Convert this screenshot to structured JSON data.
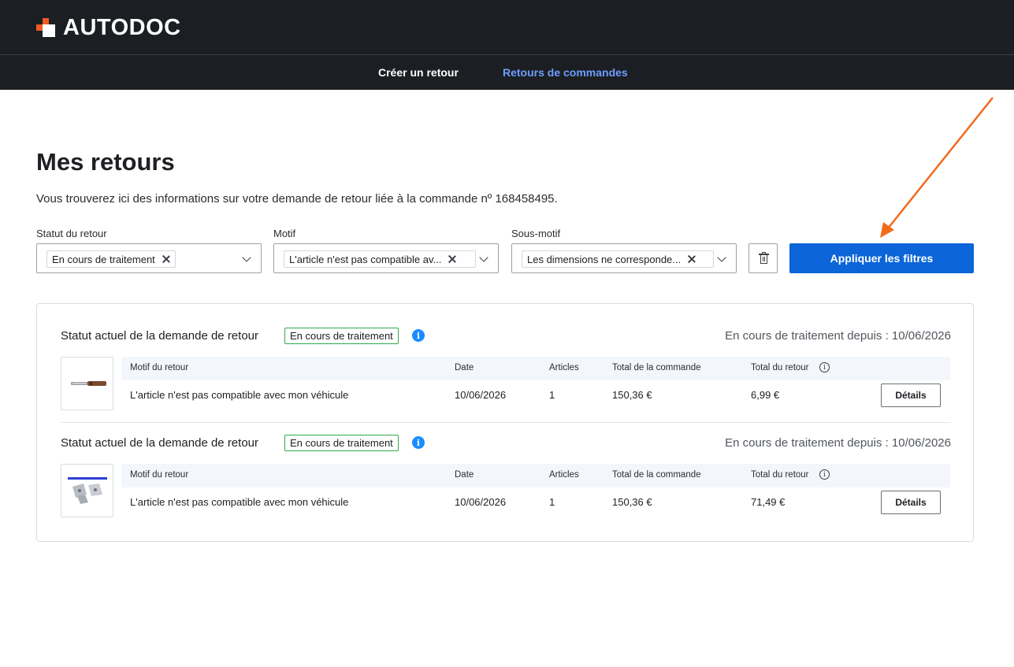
{
  "brand": {
    "name": "AUTODOC",
    "accent": "#f15a22"
  },
  "nav": {
    "items": [
      {
        "label": "Créer un retour",
        "active": false
      },
      {
        "label": "Retours de commandes",
        "active": true
      }
    ]
  },
  "page": {
    "title": "Mes retours",
    "subtitle": "Vous trouverez ici des informations sur votre demande de retour liée à la commande nº 168458495."
  },
  "filters": {
    "status": {
      "label": "Statut du retour",
      "value": "En cours de traitement"
    },
    "reason": {
      "label": "Motif",
      "value": "L'article n'est pas compatible av..."
    },
    "subreason": {
      "label": "Sous-motif",
      "value": "Les dimensions ne corresponde..."
    },
    "clear_icon": "trash-icon",
    "apply_label": "Appliquer les filtres"
  },
  "table_headers": {
    "reason": "Motif du retour",
    "date": "Date",
    "articles": "Articles",
    "order_total": "Total de la commande",
    "return_total": "Total du retour"
  },
  "returns": [
    {
      "status_title": "Statut actuel de la demande de retour",
      "status_badge": "En cours de traitement",
      "since": "En cours de traitement depuis : 10/06/2026",
      "reason": "L'article n'est pas compatible avec mon véhicule",
      "date": "10/06/2026",
      "articles": "1",
      "order_total": "150,36 €",
      "return_total": "6,99 €",
      "details_label": "Détails"
    },
    {
      "status_title": "Statut actuel de la demande de retour",
      "status_badge": "En cours de traitement",
      "since": "En cours de traitement depuis : 10/06/2026",
      "reason": "L'article n'est pas compatible avec mon véhicule",
      "date": "10/06/2026",
      "articles": "1",
      "order_total": "150,36 €",
      "return_total": "71,49 €",
      "details_label": "Détails"
    }
  ],
  "colors": {
    "header_bg": "#1b1e22",
    "nav_active": "#6e9dff",
    "primary_button": "#0b64d8",
    "badge_border": "#2fa84f",
    "info_icon": "#1a8cff",
    "annotation_arrow": "#f26b1d"
  }
}
